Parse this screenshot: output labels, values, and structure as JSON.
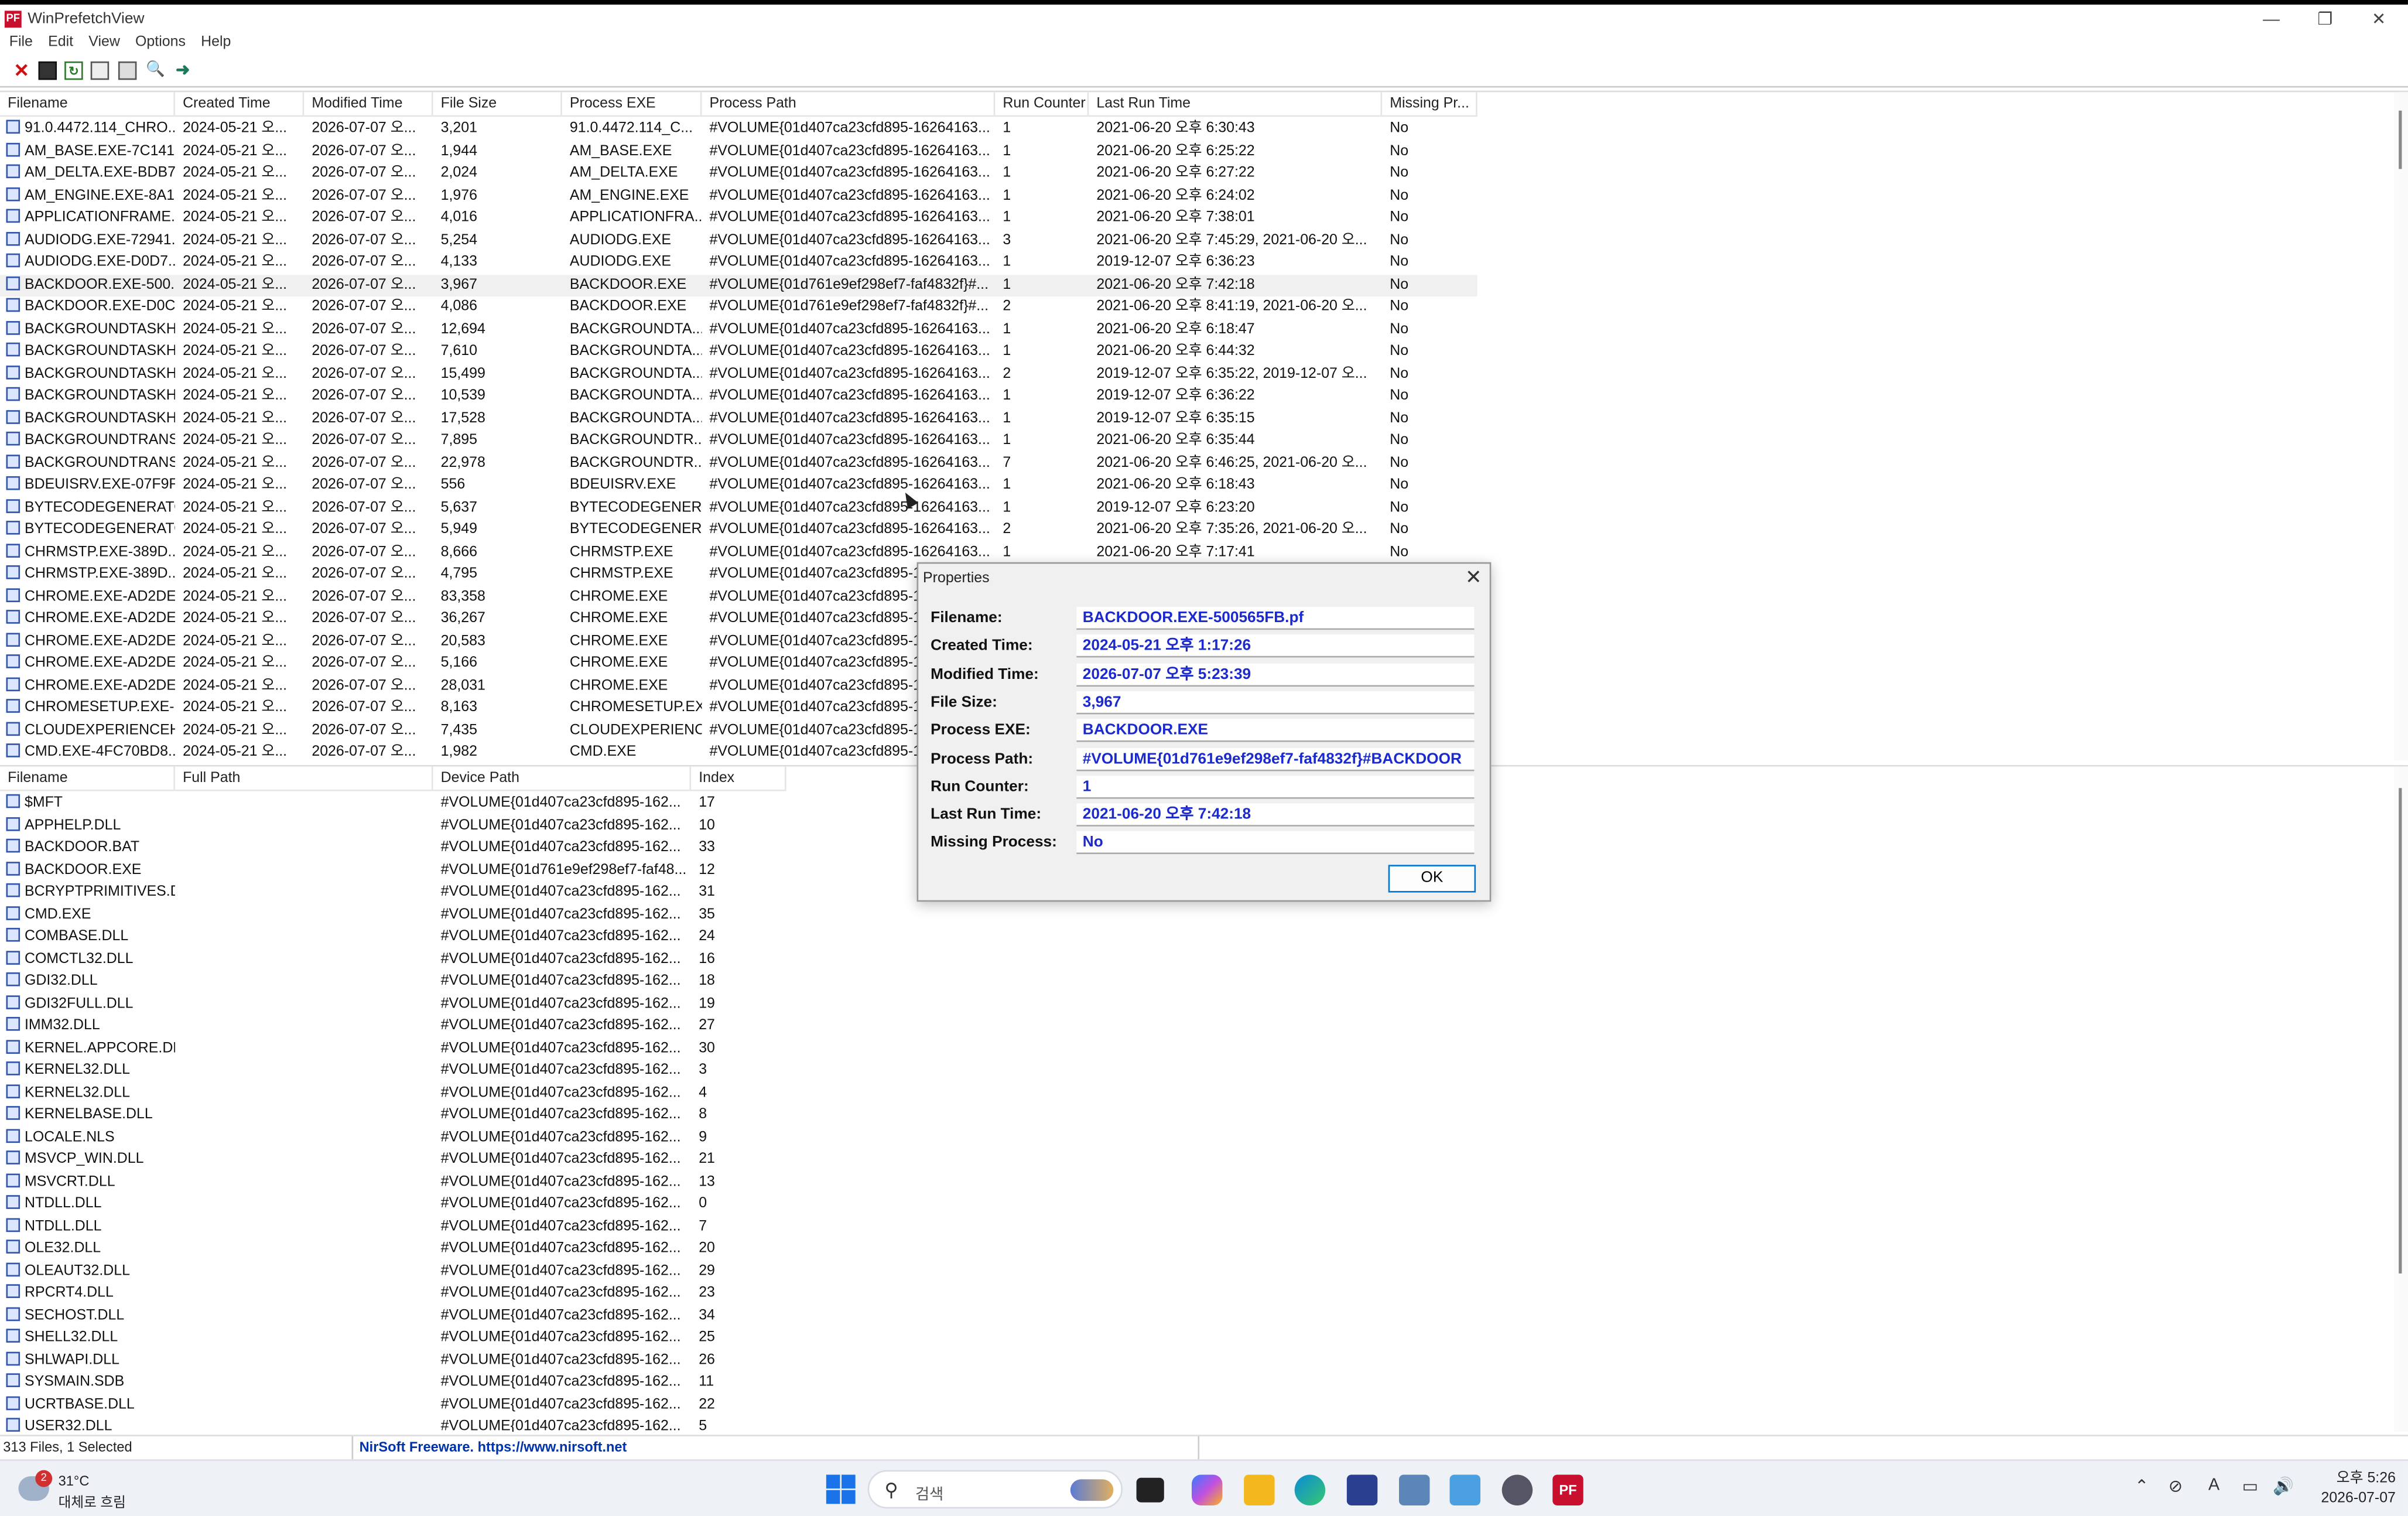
{
  "window": {
    "title": "WinPrefetchView",
    "app_icon": "PF"
  },
  "menu": [
    "File",
    "Edit",
    "View",
    "Options",
    "Help"
  ],
  "upper_table": {
    "columns": [
      "Filename",
      "Created Time",
      "Modified Time",
      "File Size",
      "Process EXE",
      "Process Path",
      "Run Counter",
      "Last Run Time",
      "Missing Pr..."
    ],
    "selected_index": 7,
    "rows": [
      [
        "91.0.4472.114_CHRO...",
        "2024-05-21 오...",
        "2026-07-07 오...",
        "3,201",
        "91.0.4472.114_C...",
        "#VOLUME{01d407ca23cfd895-16264163...",
        "1",
        "2021-06-20 오후 6:30:43",
        "No"
      ],
      [
        "AM_BASE.EXE-7C141...",
        "2024-05-21 오...",
        "2026-07-07 오...",
        "1,944",
        "AM_BASE.EXE",
        "#VOLUME{01d407ca23cfd895-16264163...",
        "1",
        "2021-06-20 오후 6:25:22",
        "No"
      ],
      [
        "AM_DELTA.EXE-BDB7...",
        "2024-05-21 오...",
        "2026-07-07 오...",
        "2,024",
        "AM_DELTA.EXE",
        "#VOLUME{01d407ca23cfd895-16264163...",
        "1",
        "2021-06-20 오후 6:27:22",
        "No"
      ],
      [
        "AM_ENGINE.EXE-8A1...",
        "2024-05-21 오...",
        "2026-07-07 오...",
        "1,976",
        "AM_ENGINE.EXE",
        "#VOLUME{01d407ca23cfd895-16264163...",
        "1",
        "2021-06-20 오후 6:24:02",
        "No"
      ],
      [
        "APPLICATIONFRAME...",
        "2024-05-21 오...",
        "2026-07-07 오...",
        "4,016",
        "APPLICATIONFRA...",
        "#VOLUME{01d407ca23cfd895-16264163...",
        "1",
        "2021-06-20 오후 7:38:01",
        "No"
      ],
      [
        "AUDIODG.EXE-72941...",
        "2024-05-21 오...",
        "2026-07-07 오...",
        "5,254",
        "AUDIODG.EXE",
        "#VOLUME{01d407ca23cfd895-16264163...",
        "3",
        "2021-06-20 오후 7:45:29, 2021-06-20 오...",
        "No"
      ],
      [
        "AUDIODG.EXE-D0D7...",
        "2024-05-21 오...",
        "2026-07-07 오...",
        "4,133",
        "AUDIODG.EXE",
        "#VOLUME{01d407ca23cfd895-16264163...",
        "1",
        "2019-12-07 오후 6:36:23",
        "No"
      ],
      [
        "BACKDOOR.EXE-500...",
        "2024-05-21 오...",
        "2026-07-07 오...",
        "3,967",
        "BACKDOOR.EXE",
        "#VOLUME{01d761e9ef298ef7-faf4832f}#...",
        "1",
        "2021-06-20 오후 7:42:18",
        "No"
      ],
      [
        "BACKDOOR.EXE-D0C...",
        "2024-05-21 오...",
        "2026-07-07 오...",
        "4,086",
        "BACKDOOR.EXE",
        "#VOLUME{01d761e9ef298ef7-faf4832f}#...",
        "2",
        "2021-06-20 오후 8:41:19, 2021-06-20 오...",
        "No"
      ],
      [
        "BACKGROUNDTASKH...",
        "2024-05-21 오...",
        "2026-07-07 오...",
        "12,694",
        "BACKGROUNDTA...",
        "#VOLUME{01d407ca23cfd895-16264163...",
        "1",
        "2021-06-20 오후 6:18:47",
        "No"
      ],
      [
        "BACKGROUNDTASKH...",
        "2024-05-21 오...",
        "2026-07-07 오...",
        "7,610",
        "BACKGROUNDTA...",
        "#VOLUME{01d407ca23cfd895-16264163...",
        "1",
        "2021-06-20 오후 6:44:32",
        "No"
      ],
      [
        "BACKGROUNDTASKH...",
        "2024-05-21 오...",
        "2026-07-07 오...",
        "15,499",
        "BACKGROUNDTA...",
        "#VOLUME{01d407ca23cfd895-16264163...",
        "2",
        "2019-12-07 오후 6:35:22, 2019-12-07 오...",
        "No"
      ],
      [
        "BACKGROUNDTASKH...",
        "2024-05-21 오...",
        "2026-07-07 오...",
        "10,539",
        "BACKGROUNDTA...",
        "#VOLUME{01d407ca23cfd895-16264163...",
        "1",
        "2019-12-07 오후 6:36:22",
        "No"
      ],
      [
        "BACKGROUNDTASKH...",
        "2024-05-21 오...",
        "2026-07-07 오...",
        "17,528",
        "BACKGROUNDTA...",
        "#VOLUME{01d407ca23cfd895-16264163...",
        "1",
        "2019-12-07 오후 6:35:15",
        "No"
      ],
      [
        "BACKGROUNDTRANS...",
        "2024-05-21 오...",
        "2026-07-07 오...",
        "7,895",
        "BACKGROUNDTR...",
        "#VOLUME{01d407ca23cfd895-16264163...",
        "1",
        "2021-06-20 오후 6:35:44",
        "No"
      ],
      [
        "BACKGROUNDTRANS...",
        "2024-05-21 오...",
        "2026-07-07 오...",
        "22,978",
        "BACKGROUNDTR...",
        "#VOLUME{01d407ca23cfd895-16264163...",
        "7",
        "2021-06-20 오후 6:46:25, 2021-06-20 오...",
        "No"
      ],
      [
        "BDEUISRV.EXE-07F9F...",
        "2024-05-21 오...",
        "2026-07-07 오...",
        "556",
        "BDEUISRV.EXE",
        "#VOLUME{01d407ca23cfd895-16264163...",
        "1",
        "2021-06-20 오후 6:18:43",
        "No"
      ],
      [
        "BYTECODEGENERATO...",
        "2024-05-21 오...",
        "2026-07-07 오...",
        "5,637",
        "BYTECODEGENER...",
        "#VOLUME{01d407ca23cfd895-16264163...",
        "1",
        "2019-12-07 오후 6:23:20",
        "No"
      ],
      [
        "BYTECODEGENERATO...",
        "2024-05-21 오...",
        "2026-07-07 오...",
        "5,949",
        "BYTECODEGENER...",
        "#VOLUME{01d407ca23cfd895-16264163...",
        "2",
        "2021-06-20 오후 7:35:26, 2021-06-20 오...",
        "No"
      ],
      [
        "CHRMSTP.EXE-389D...",
        "2024-05-21 오...",
        "2026-07-07 오...",
        "8,666",
        "CHRMSTP.EXE",
        "#VOLUME{01d407ca23cfd895-16264163...",
        "1",
        "2021-06-20 오후 7:17:41",
        "No"
      ],
      [
        "CHRMSTP.EXE-389D...",
        "2024-05-21 오...",
        "2026-07-07 오...",
        "4,795",
        "CHRMSTP.EXE",
        "#VOLUME{01d407ca23cfd895-1",
        "",
        "",
        ""
      ],
      [
        "CHROME.EXE-AD2DE...",
        "2024-05-21 오...",
        "2026-07-07 오...",
        "83,358",
        "CHROME.EXE",
        "#VOLUME{01d407ca23cfd895-1",
        "",
        "",
        ""
      ],
      [
        "CHROME.EXE-AD2DE...",
        "2024-05-21 오...",
        "2026-07-07 오...",
        "36,267",
        "CHROME.EXE",
        "#VOLUME{01d407ca23cfd895-1",
        "",
        "",
        ""
      ],
      [
        "CHROME.EXE-AD2DE...",
        "2024-05-21 오...",
        "2026-07-07 오...",
        "20,583",
        "CHROME.EXE",
        "#VOLUME{01d407ca23cfd895-1",
        "",
        "",
        ""
      ],
      [
        "CHROME.EXE-AD2DE...",
        "2024-05-21 오...",
        "2026-07-07 오...",
        "5,166",
        "CHROME.EXE",
        "#VOLUME{01d407ca23cfd895-1",
        "",
        "",
        ""
      ],
      [
        "CHROME.EXE-AD2DE...",
        "2024-05-21 오...",
        "2026-07-07 오...",
        "28,031",
        "CHROME.EXE",
        "#VOLUME{01d407ca23cfd895-1",
        "",
        "",
        ""
      ],
      [
        "CHROMESETUP.EXE-...",
        "2024-05-21 오...",
        "2026-07-07 오...",
        "8,163",
        "CHROMESETUP.EXE",
        "#VOLUME{01d407ca23cfd895-1",
        "",
        "",
        ""
      ],
      [
        "CLOUDEXPERIENCEH...",
        "2024-05-21 오...",
        "2026-07-07 오...",
        "7,435",
        "CLOUDEXPERIENC...",
        "#VOLUME{01d407ca23cfd895-1",
        "",
        "",
        ""
      ],
      [
        "CMD.EXE-4FC70BD8...",
        "2024-05-21 오...",
        "2026-07-07 오...",
        "1,982",
        "CMD.EXE",
        "#VOLUME{01d407ca23cfd895-1",
        "",
        "",
        ""
      ]
    ]
  },
  "lower_table": {
    "columns": [
      "Filename",
      "Full Path",
      "Device Path",
      "Index"
    ],
    "rows": [
      [
        "$MFT",
        "",
        "#VOLUME{01d407ca23cfd895-162...",
        "17"
      ],
      [
        "APPHELP.DLL",
        "",
        "#VOLUME{01d407ca23cfd895-162...",
        "10"
      ],
      [
        "BACKDOOR.BAT",
        "",
        "#VOLUME{01d407ca23cfd895-162...",
        "33"
      ],
      [
        "BACKDOOR.EXE",
        "",
        "#VOLUME{01d761e9ef298ef7-faf48...",
        "12"
      ],
      [
        "BCRYPTPRIMITIVES.D...",
        "",
        "#VOLUME{01d407ca23cfd895-162...",
        "31"
      ],
      [
        "CMD.EXE",
        "",
        "#VOLUME{01d407ca23cfd895-162...",
        "35"
      ],
      [
        "COMBASE.DLL",
        "",
        "#VOLUME{01d407ca23cfd895-162...",
        "24"
      ],
      [
        "COMCTL32.DLL",
        "",
        "#VOLUME{01d407ca23cfd895-162...",
        "16"
      ],
      [
        "GDI32.DLL",
        "",
        "#VOLUME{01d407ca23cfd895-162...",
        "18"
      ],
      [
        "GDI32FULL.DLL",
        "",
        "#VOLUME{01d407ca23cfd895-162...",
        "19"
      ],
      [
        "IMM32.DLL",
        "",
        "#VOLUME{01d407ca23cfd895-162...",
        "27"
      ],
      [
        "KERNEL.APPCORE.DLL",
        "",
        "#VOLUME{01d407ca23cfd895-162...",
        "30"
      ],
      [
        "KERNEL32.DLL",
        "",
        "#VOLUME{01d407ca23cfd895-162...",
        "3"
      ],
      [
        "KERNEL32.DLL",
        "",
        "#VOLUME{01d407ca23cfd895-162...",
        "4"
      ],
      [
        "KERNELBASE.DLL",
        "",
        "#VOLUME{01d407ca23cfd895-162...",
        "8"
      ],
      [
        "LOCALE.NLS",
        "",
        "#VOLUME{01d407ca23cfd895-162...",
        "9"
      ],
      [
        "MSVCP_WIN.DLL",
        "",
        "#VOLUME{01d407ca23cfd895-162...",
        "21"
      ],
      [
        "MSVCRT.DLL",
        "",
        "#VOLUME{01d407ca23cfd895-162...",
        "13"
      ],
      [
        "NTDLL.DLL",
        "",
        "#VOLUME{01d407ca23cfd895-162...",
        "0"
      ],
      [
        "NTDLL.DLL",
        "",
        "#VOLUME{01d407ca23cfd895-162...",
        "7"
      ],
      [
        "OLE32.DLL",
        "",
        "#VOLUME{01d407ca23cfd895-162...",
        "20"
      ],
      [
        "OLEAUT32.DLL",
        "",
        "#VOLUME{01d407ca23cfd895-162...",
        "29"
      ],
      [
        "RPCRT4.DLL",
        "",
        "#VOLUME{01d407ca23cfd895-162...",
        "23"
      ],
      [
        "SECHOST.DLL",
        "",
        "#VOLUME{01d407ca23cfd895-162...",
        "34"
      ],
      [
        "SHELL32.DLL",
        "",
        "#VOLUME{01d407ca23cfd895-162...",
        "25"
      ],
      [
        "SHLWAPI.DLL",
        "",
        "#VOLUME{01d407ca23cfd895-162...",
        "26"
      ],
      [
        "SYSMAIN.SDB",
        "",
        "#VOLUME{01d407ca23cfd895-162...",
        "11"
      ],
      [
        "UCRTBASE.DLL",
        "",
        "#VOLUME{01d407ca23cfd895-162...",
        "22"
      ],
      [
        "USER32.DLL",
        "",
        "#VOLUME{01d407ca23cfd895-162...",
        "5"
      ]
    ]
  },
  "dialog": {
    "title": "Properties",
    "close_glyph": "✕",
    "fields": [
      {
        "label": "Filename:",
        "value": "BACKDOOR.EXE-500565FB.pf"
      },
      {
        "label": "Created Time:",
        "value": "2024-05-21 오후 1:17:26"
      },
      {
        "label": "Modified Time:",
        "value": "2026-07-07 오후 5:23:39"
      },
      {
        "label": "File Size:",
        "value": "3,967"
      },
      {
        "label": "Process EXE:",
        "value": "BACKDOOR.EXE"
      },
      {
        "label": "Process Path:",
        "value": "#VOLUME{01d761e9ef298ef7-faf4832f}#BACKDOOR"
      },
      {
        "label": "Run Counter:",
        "value": "1"
      },
      {
        "label": "Last Run Time:",
        "value": "2021-06-20 오후 7:42:18"
      },
      {
        "label": "Missing Process:",
        "value": "No"
      }
    ],
    "ok_label": "OK"
  },
  "status": {
    "count": "313 Files, 1 Selected",
    "credit": "NirSoft Freeware. https://www.nirsoft.net"
  },
  "taskbar": {
    "weather_temp": "31°C",
    "weather_desc": "대체로 흐림",
    "weather_badge": "2",
    "search_placeholder": "검색",
    "clock_time": "오후 5:26",
    "clock_date": "2026-07-07",
    "pf_icon": "PF"
  },
  "colors": {
    "accent": "#0078d4",
    "dialog_value": "#1a2acc",
    "credit": "#0033aa"
  }
}
